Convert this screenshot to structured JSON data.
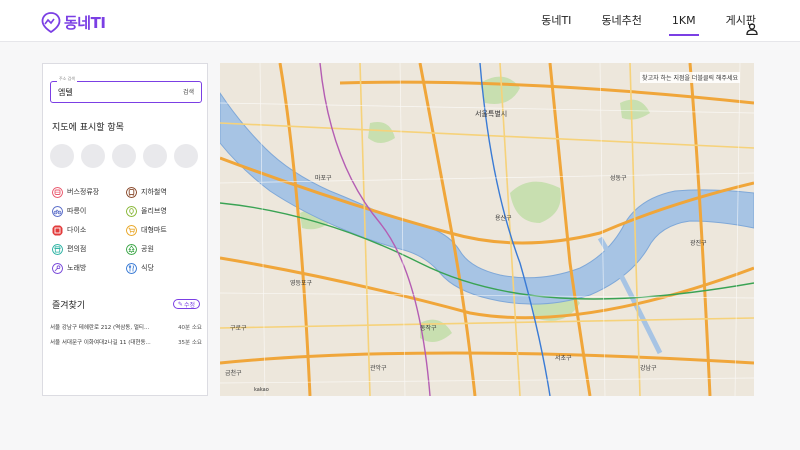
{
  "brand": {
    "name": "동네TI",
    "color": "#7b3fe4"
  },
  "nav": {
    "items": [
      {
        "label": "동네TI",
        "active": false
      },
      {
        "label": "동네추천",
        "active": false
      },
      {
        "label": "1KM",
        "active": true
      },
      {
        "label": "게시판",
        "active": false
      }
    ],
    "user_icon": "user-icon"
  },
  "search": {
    "legend": "주소 검색",
    "value": "엠텔",
    "button": "검색"
  },
  "map_items": {
    "title": "지도에 표시할 항목",
    "items": [
      {
        "label": "버스정류장",
        "icon": "bus-icon",
        "color": "#e95a6f"
      },
      {
        "label": "지하철역",
        "icon": "subway-icon",
        "color": "#8a4b2d"
      },
      {
        "label": "따릉이",
        "icon": "bike-icon",
        "color": "#5b6ec9"
      },
      {
        "label": "올리브영",
        "icon": "olive-icon",
        "color": "#8ab83a"
      },
      {
        "label": "다이소",
        "icon": "daiso-icon",
        "color": "#e23b3b"
      },
      {
        "label": "대형마트",
        "icon": "cart-icon",
        "color": "#e9a82a"
      },
      {
        "label": "편의점",
        "icon": "store-icon",
        "color": "#2fb3a4"
      },
      {
        "label": "공원",
        "icon": "park-icon",
        "color": "#3fa84a"
      },
      {
        "label": "노래방",
        "icon": "mic-icon",
        "color": "#7a4ad9"
      },
      {
        "label": "식당",
        "icon": "fork-icon",
        "color": "#3a7bd5"
      }
    ]
  },
  "favorites": {
    "title": "즐겨찾기",
    "edit_label": "수정",
    "rows": [
      {
        "address": "서울 강남구 테헤란로 212 (역삼동, 멀티...",
        "time": "40분 소요"
      },
      {
        "address": "서울 서대문구 이화여대2나길 11 (대현동...",
        "time": "35분 소요"
      }
    ]
  },
  "map": {
    "hint": "찾고자 하는 지점을 더블클릭 해주세요",
    "labels": [
      "서울특별시",
      "용산구",
      "동작구",
      "서초구",
      "강남구",
      "성동구",
      "광진구",
      "마포구",
      "영등포구",
      "관악구",
      "구로구",
      "금천구"
    ],
    "attribution": "kakao"
  }
}
